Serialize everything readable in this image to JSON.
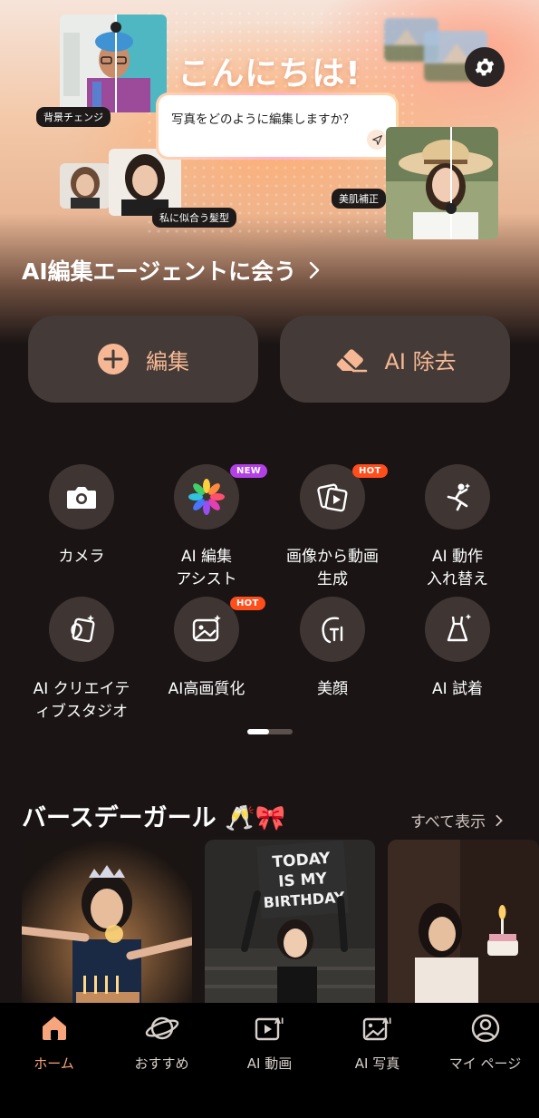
{
  "hero": {
    "greeting": "こんにちは!",
    "prompt_text": "写真をどのように編集しますか？",
    "tags": {
      "background_change": "背景チェンジ",
      "hairstyle": "私に似合う髪型",
      "skin_retouch": "美肌補正"
    },
    "link_label": "AI編集エージェントに会う"
  },
  "actions": {
    "edit_label": "編集",
    "ai_erase_label": "AI 除去"
  },
  "tools": [
    {
      "label": "カメラ",
      "icon": "camera-icon",
      "badge": ""
    },
    {
      "label": "AI 編集\nアシスト",
      "icon": "flower-icon",
      "badge": "NEW"
    },
    {
      "label": "画像から動画\n生成",
      "icon": "photo-video-icon",
      "badge": "HOT"
    },
    {
      "label": "AI 動作\n入れ替え",
      "icon": "dance-icon",
      "badge": ""
    },
    {
      "label": "AI クリエイテ\nィブスタジオ",
      "icon": "creative-studio-icon",
      "badge": ""
    },
    {
      "label": "AI高画質化",
      "icon": "enhance-image-icon",
      "badge": "HOT"
    },
    {
      "label": "美顔",
      "icon": "face-icon",
      "badge": ""
    },
    {
      "label": "AI 試着",
      "icon": "dress-icon",
      "badge": ""
    }
  ],
  "pager": {
    "page": 1,
    "pages": 2
  },
  "section": {
    "title": "バースデーガール 🥂🎀",
    "see_all": "すべて表示",
    "card2_sign": [
      "TODAY",
      "IS MY",
      "BIRTHDAY"
    ]
  },
  "nav": [
    {
      "label": "ホーム",
      "icon": "home-icon",
      "active": true
    },
    {
      "label": "おすすめ",
      "icon": "planet-icon",
      "active": false
    },
    {
      "label": "AI 動画",
      "icon": "ai-video-icon",
      "active": false
    },
    {
      "label": "AI 写真",
      "icon": "ai-photo-icon",
      "active": false
    },
    {
      "label": "マイ ページ",
      "icon": "profile-icon",
      "active": false
    }
  ],
  "colors": {
    "accent": "#F6A57C",
    "button_bg": "#443B38",
    "badge_new": "#B340E6",
    "badge_hot": "#FF4D1C",
    "background": "#1A1414"
  }
}
